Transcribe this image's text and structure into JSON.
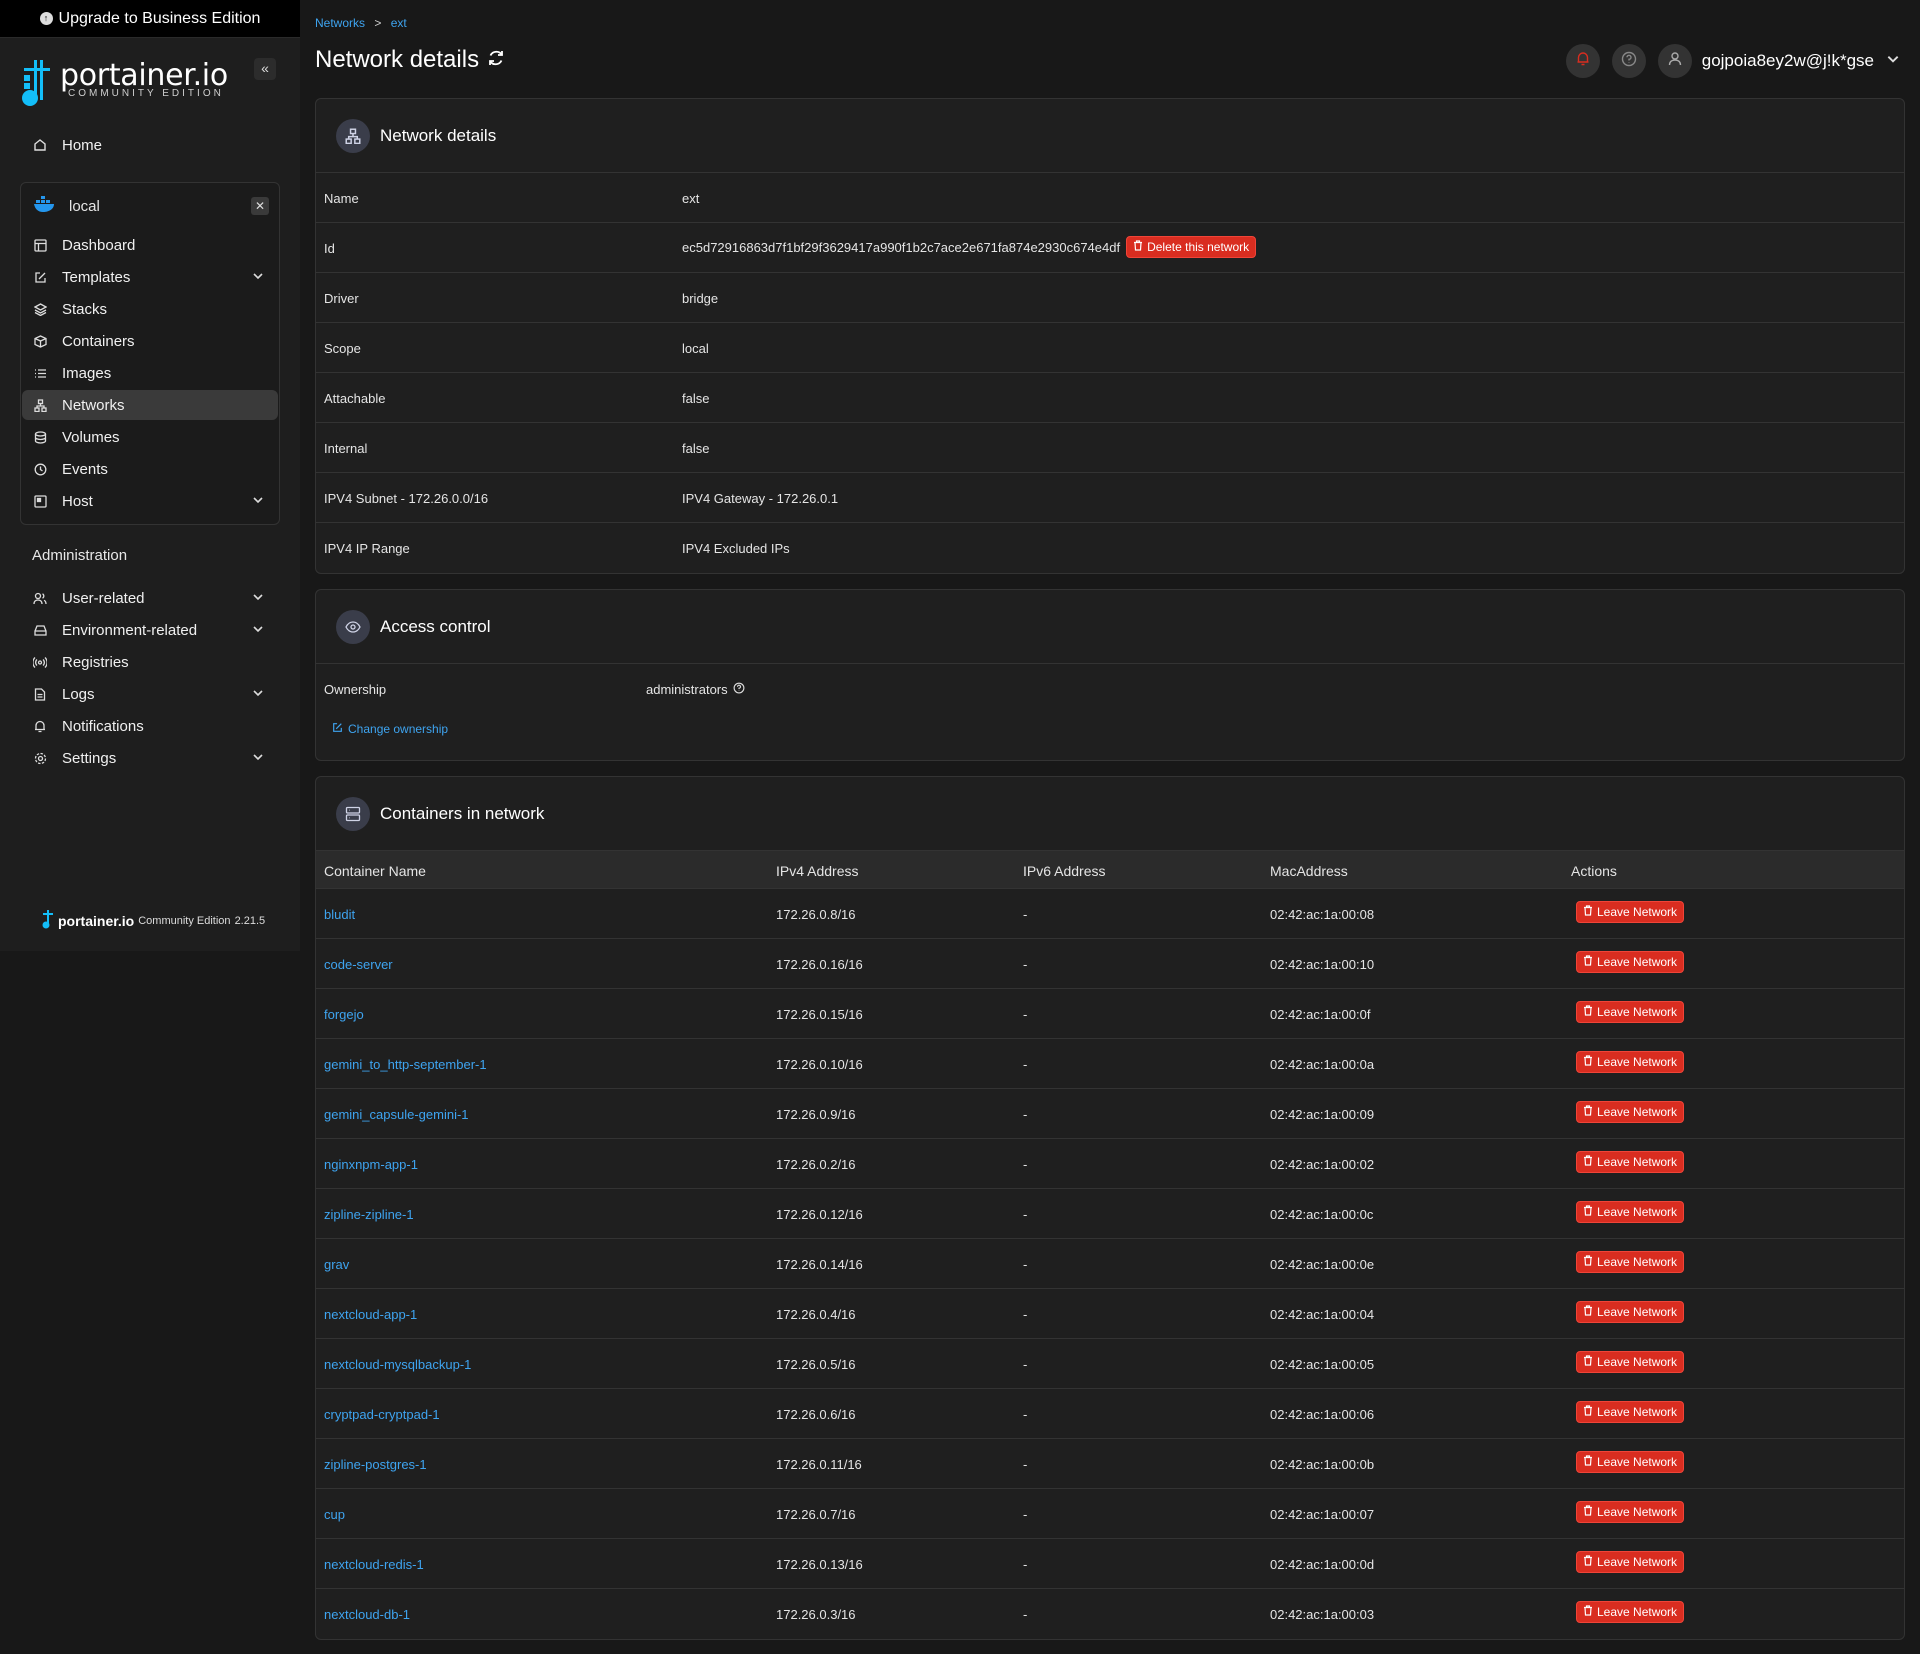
{
  "upgrade_banner": {
    "label": "Upgrade to Business Edition"
  },
  "brand": {
    "name": "portainer.io",
    "edition": "COMMUNITY EDITION"
  },
  "sidebar": {
    "home": "Home",
    "environment": {
      "name": "local"
    },
    "env_items": [
      {
        "label": "Dashboard",
        "icon": "dashboard-icon"
      },
      {
        "label": "Templates",
        "icon": "edit-icon",
        "expandable": true
      },
      {
        "label": "Stacks",
        "icon": "layers-icon"
      },
      {
        "label": "Containers",
        "icon": "box-icon"
      },
      {
        "label": "Images",
        "icon": "list-icon"
      },
      {
        "label": "Networks",
        "icon": "network-icon",
        "active": true
      },
      {
        "label": "Volumes",
        "icon": "database-icon"
      },
      {
        "label": "Events",
        "icon": "clock-icon"
      },
      {
        "label": "Host",
        "icon": "server-icon",
        "expandable": true
      }
    ],
    "admin_title": "Administration",
    "admin_items": [
      {
        "label": "User-related",
        "icon": "users-icon",
        "expandable": true
      },
      {
        "label": "Environment-related",
        "icon": "drive-icon",
        "expandable": true
      },
      {
        "label": "Registries",
        "icon": "radio-icon"
      },
      {
        "label": "Logs",
        "icon": "file-icon",
        "expandable": true
      },
      {
        "label": "Notifications",
        "icon": "bell-icon"
      },
      {
        "label": "Settings",
        "icon": "gear-icon",
        "expandable": true
      }
    ],
    "footer": {
      "brand": "portainer.io",
      "edition": "Community Edition",
      "version": "2.21.5"
    }
  },
  "breadcrumb": {
    "parent": "Networks",
    "sep": ">",
    "current": "ext"
  },
  "page_title": "Network details",
  "user": {
    "name": "gojpoia8ey2w@j!k*gse"
  },
  "network_details": {
    "title": "Network details",
    "rows": [
      {
        "key": "Name",
        "value": "ext"
      },
      {
        "key": "Id",
        "value": "ec5d72916863d7f1bf29f3629417a990f1b2c7ace2e671fa874e2930c674e4df"
      },
      {
        "key": "Driver",
        "value": "bridge"
      },
      {
        "key": "Scope",
        "value": "local"
      },
      {
        "key": "Attachable",
        "value": "false"
      },
      {
        "key": "Internal",
        "value": "false"
      },
      {
        "key": "IPV4 Subnet - 172.26.0.0/16",
        "value": "IPV4 Gateway - 172.26.0.1"
      },
      {
        "key": "IPV4 IP Range",
        "value": "IPV4 Excluded IPs"
      }
    ],
    "delete_label": "Delete this network"
  },
  "access_control": {
    "title": "Access control",
    "ownership_label": "Ownership",
    "ownership_value": "administrators",
    "change_label": "Change ownership"
  },
  "containers": {
    "title": "Containers in network",
    "columns": [
      "Container Name",
      "IPv4 Address",
      "IPv6 Address",
      "MacAddress",
      "Actions"
    ],
    "action_label": "Leave Network",
    "rows": [
      {
        "name": "bludit",
        "ipv4": "172.26.0.8/16",
        "ipv6": "-",
        "mac": "02:42:ac:1a:00:08"
      },
      {
        "name": "code-server",
        "ipv4": "172.26.0.16/16",
        "ipv6": "-",
        "mac": "02:42:ac:1a:00:10"
      },
      {
        "name": "forgejo",
        "ipv4": "172.26.0.15/16",
        "ipv6": "-",
        "mac": "02:42:ac:1a:00:0f"
      },
      {
        "name": "gemini_to_http-september-1",
        "ipv4": "172.26.0.10/16",
        "ipv6": "-",
        "mac": "02:42:ac:1a:00:0a"
      },
      {
        "name": "gemini_capsule-gemini-1",
        "ipv4": "172.26.0.9/16",
        "ipv6": "-",
        "mac": "02:42:ac:1a:00:09"
      },
      {
        "name": "nginxnpm-app-1",
        "ipv4": "172.26.0.2/16",
        "ipv6": "-",
        "mac": "02:42:ac:1a:00:02"
      },
      {
        "name": "zipline-zipline-1",
        "ipv4": "172.26.0.12/16",
        "ipv6": "-",
        "mac": "02:42:ac:1a:00:0c"
      },
      {
        "name": "grav",
        "ipv4": "172.26.0.14/16",
        "ipv6": "-",
        "mac": "02:42:ac:1a:00:0e"
      },
      {
        "name": "nextcloud-app-1",
        "ipv4": "172.26.0.4/16",
        "ipv6": "-",
        "mac": "02:42:ac:1a:00:04"
      },
      {
        "name": "nextcloud-mysqlbackup-1",
        "ipv4": "172.26.0.5/16",
        "ipv6": "-",
        "mac": "02:42:ac:1a:00:05"
      },
      {
        "name": "cryptpad-cryptpad-1",
        "ipv4": "172.26.0.6/16",
        "ipv6": "-",
        "mac": "02:42:ac:1a:00:06"
      },
      {
        "name": "zipline-postgres-1",
        "ipv4": "172.26.0.11/16",
        "ipv6": "-",
        "mac": "02:42:ac:1a:00:0b"
      },
      {
        "name": "cup",
        "ipv4": "172.26.0.7/16",
        "ipv6": "-",
        "mac": "02:42:ac:1a:00:07"
      },
      {
        "name": "nextcloud-redis-1",
        "ipv4": "172.26.0.13/16",
        "ipv6": "-",
        "mac": "02:42:ac:1a:00:0d"
      },
      {
        "name": "nextcloud-db-1",
        "ipv4": "172.26.0.3/16",
        "ipv6": "-",
        "mac": "02:42:ac:1a:00:03"
      }
    ]
  },
  "colors": {
    "accent": "#3ea4f0",
    "danger": "#d92d20",
    "background": "#181818",
    "panel": "#1f1f1f"
  }
}
